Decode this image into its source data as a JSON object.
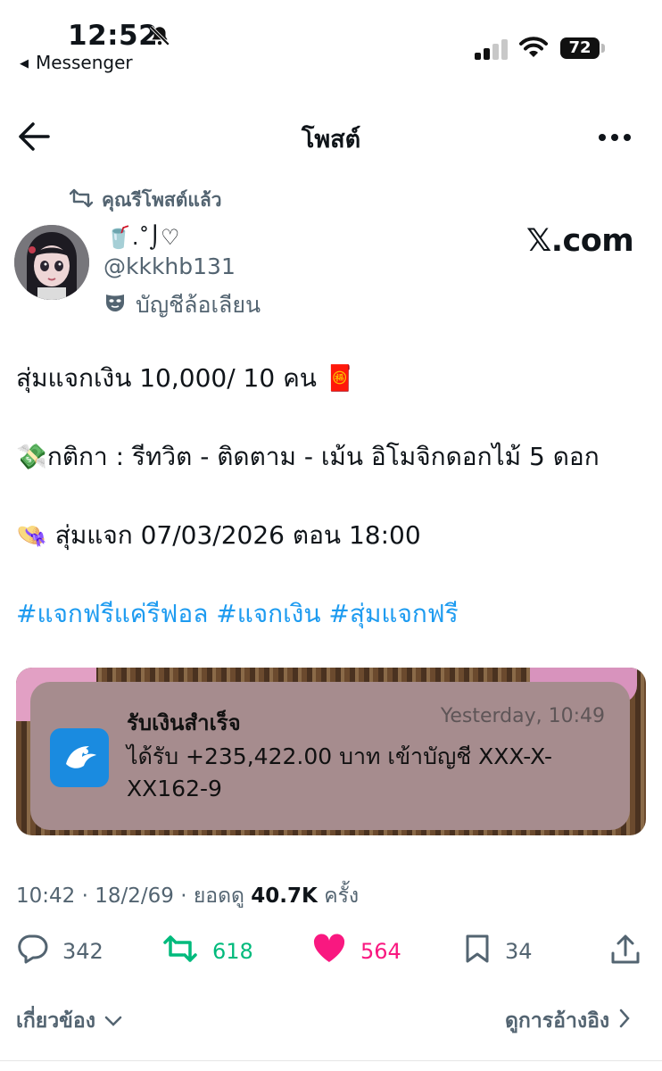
{
  "status_bar": {
    "time": "12:52",
    "back_app": "Messenger",
    "battery": "72"
  },
  "header": {
    "title": "โพสต์"
  },
  "post": {
    "repost_text": "คุณรีโพสต์แล้ว",
    "display_name": "🥤.˚⌡♡",
    "handle": "@kkkhb131",
    "parody_label": "บัญชีล้อเลียน",
    "watermark": "𝕏.com",
    "line1": "สุ่มแจกเงิน 10,000/ 10  คน 🧧",
    "line2": "💸กติกา : รีทวิต - ติดตาม - เม้น อิโมจิกดอกไม้ 5 ดอก",
    "line3": "👒 สุ่มแจก 07/03/2026 ตอน 18:00",
    "hashtags": "#แจกฟรีแค่รีฟอล #แจกเงิน #สุ่มแจกฟรี"
  },
  "media": {
    "notification_title": "รับเงินสำเร็จ",
    "notification_time": "Yesterday, 10:49",
    "notification_body": "ได้รับ +235,422.00 บาท เข้าบัญชี XXX-X-XX162-9"
  },
  "meta": {
    "timestamp": "10:42 · 18/2/69 · ยอดดู",
    "views": "40.7K",
    "views_suffix": "ครั้ง"
  },
  "actions": {
    "replies": "342",
    "reposts": "618",
    "likes": "564",
    "bookmarks": "34"
  },
  "footer": {
    "related": "เกี่ยวข้อง",
    "view_quotes": "ดูการอ้างอิง"
  },
  "colors": {
    "link": "#1d9bf0",
    "repost_active": "#00ba7c",
    "like_active": "#f91880",
    "muted": "#536471"
  }
}
